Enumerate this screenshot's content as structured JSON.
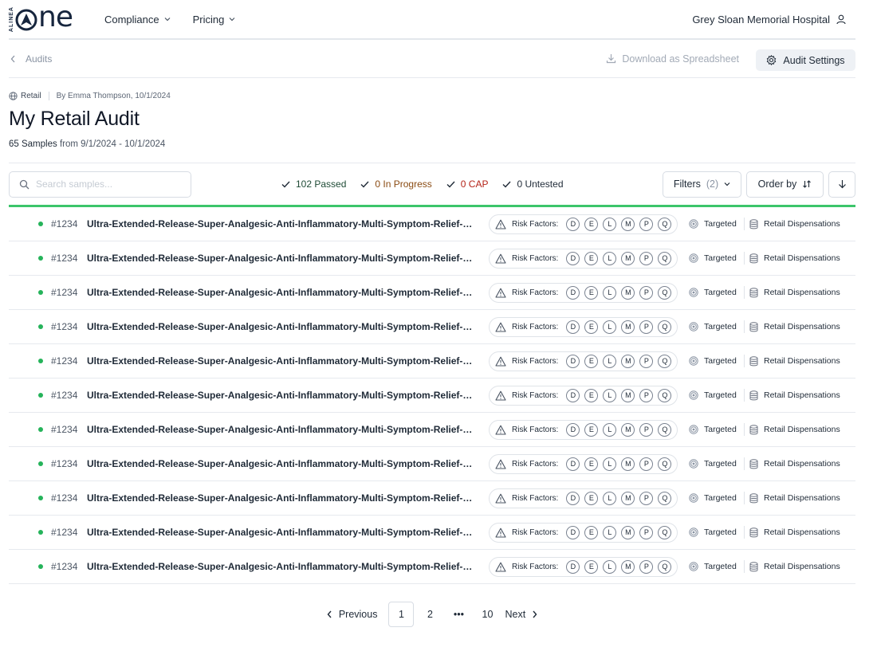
{
  "brand": {
    "mark_text": "ALINEA",
    "wordmark": "ne"
  },
  "nav": {
    "items": [
      {
        "label": "Compliance"
      },
      {
        "label": "Pricing"
      }
    ]
  },
  "org": {
    "name": "Grey Sloan Memorial Hospital"
  },
  "subbar": {
    "back_label": "Audits",
    "download_label": "Download as Spreadsheet",
    "settings_label": "Audit Settings"
  },
  "audit": {
    "type_tag": "Retail",
    "byline": "By Emma Thompson, 10/1/2024",
    "title": "My Retail Audit",
    "sample_count": "65 Samples",
    "date_range": "from 9/1/2024 - 10/1/2024"
  },
  "search": {
    "placeholder": "Search samples..."
  },
  "status": {
    "passed": "102 Passed",
    "in_progress": "0 In Progress",
    "cap": "0 CAP",
    "untested": "0 Untested"
  },
  "controls": {
    "filters_label": "Filters",
    "filters_count": "(2)",
    "order_label": "Order by"
  },
  "rows": [
    {
      "id": "#1234",
      "name": "Ultra-Extended-Release-Super-Analgesic-Anti-Inflammatory-Multi-Symptom-Relief-Co...",
      "risk_label": "Risk Factors:",
      "factors": [
        "D",
        "E",
        "L",
        "M",
        "P",
        "Q"
      ],
      "selection": "Targeted",
      "source": "Retail Dispensations"
    },
    {
      "id": "#1234",
      "name": "Ultra-Extended-Release-Super-Analgesic-Anti-Inflammatory-Multi-Symptom-Relief-Co...",
      "risk_label": "Risk Factors:",
      "factors": [
        "D",
        "E",
        "L",
        "M",
        "P",
        "Q"
      ],
      "selection": "Targeted",
      "source": "Retail Dispensations"
    },
    {
      "id": "#1234",
      "name": "Ultra-Extended-Release-Super-Analgesic-Anti-Inflammatory-Multi-Symptom-Relief-Co...",
      "risk_label": "Risk Factors:",
      "factors": [
        "D",
        "E",
        "L",
        "M",
        "P",
        "Q"
      ],
      "selection": "Targeted",
      "source": "Retail Dispensations"
    },
    {
      "id": "#1234",
      "name": "Ultra-Extended-Release-Super-Analgesic-Anti-Inflammatory-Multi-Symptom-Relief-Co...",
      "risk_label": "Risk Factors:",
      "factors": [
        "D",
        "E",
        "L",
        "M",
        "P",
        "Q"
      ],
      "selection": "Targeted",
      "source": "Retail Dispensations"
    },
    {
      "id": "#1234",
      "name": "Ultra-Extended-Release-Super-Analgesic-Anti-Inflammatory-Multi-Symptom-Relief-Co...",
      "risk_label": "Risk Factors:",
      "factors": [
        "D",
        "E",
        "L",
        "M",
        "P",
        "Q"
      ],
      "selection": "Targeted",
      "source": "Retail Dispensations"
    },
    {
      "id": "#1234",
      "name": "Ultra-Extended-Release-Super-Analgesic-Anti-Inflammatory-Multi-Symptom-Relief-Co...",
      "risk_label": "Risk Factors:",
      "factors": [
        "D",
        "E",
        "L",
        "M",
        "P",
        "Q"
      ],
      "selection": "Targeted",
      "source": "Retail Dispensations"
    },
    {
      "id": "#1234",
      "name": "Ultra-Extended-Release-Super-Analgesic-Anti-Inflammatory-Multi-Symptom-Relief-Co...",
      "risk_label": "Risk Factors:",
      "factors": [
        "D",
        "E",
        "L",
        "M",
        "P",
        "Q"
      ],
      "selection": "Targeted",
      "source": "Retail Dispensations"
    },
    {
      "id": "#1234",
      "name": "Ultra-Extended-Release-Super-Analgesic-Anti-Inflammatory-Multi-Symptom-Relief-Co...",
      "risk_label": "Risk Factors:",
      "factors": [
        "D",
        "E",
        "L",
        "M",
        "P",
        "Q"
      ],
      "selection": "Targeted",
      "source": "Retail Dispensations"
    },
    {
      "id": "#1234",
      "name": "Ultra-Extended-Release-Super-Analgesic-Anti-Inflammatory-Multi-Symptom-Relief-Co...",
      "risk_label": "Risk Factors:",
      "factors": [
        "D",
        "E",
        "L",
        "M",
        "P",
        "Q"
      ],
      "selection": "Targeted",
      "source": "Retail Dispensations"
    },
    {
      "id": "#1234",
      "name": "Ultra-Extended-Release-Super-Analgesic-Anti-Inflammatory-Multi-Symptom-Relief-Co...",
      "risk_label": "Risk Factors:",
      "factors": [
        "D",
        "E",
        "L",
        "M",
        "P",
        "Q"
      ],
      "selection": "Targeted",
      "source": "Retail Dispensations"
    },
    {
      "id": "#1234",
      "name": "Ultra-Extended-Release-Super-Analgesic-Anti-Inflammatory-Multi-Symptom-Relief-Co...",
      "risk_label": "Risk Factors:",
      "factors": [
        "D",
        "E",
        "L",
        "M",
        "P",
        "Q"
      ],
      "selection": "Targeted",
      "source": "Retail Dispensations"
    }
  ],
  "pagination": {
    "previous_label": "Previous",
    "next_label": "Next",
    "pages": [
      "1",
      "2",
      "•••",
      "10"
    ],
    "current": "1"
  },
  "colors": {
    "accent_green": "#3cc56b",
    "status_dot": "#25b35a",
    "passed_text": "#1f4b36",
    "in_progress_text": "#8a4b12",
    "cap_text": "#b42318"
  },
  "icons": {
    "user": "user-icon",
    "back": "chevron-left-icon",
    "download": "download-icon",
    "settings": "gear-icon",
    "globe": "globe-icon",
    "search": "search-icon",
    "check": "check-icon",
    "warning": "warning-icon",
    "target": "target-icon",
    "database": "database-icon",
    "sort": "sort-icon",
    "arrow_down": "arrow-down-icon"
  }
}
